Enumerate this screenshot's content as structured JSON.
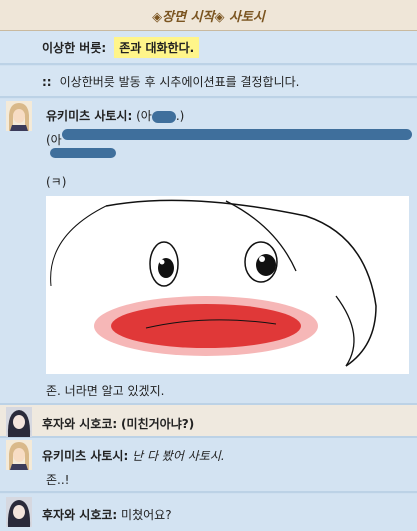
{
  "header": {
    "title": "◈장면 시작◈ 사토시"
  },
  "system": {
    "choice_label": "이상한 버릇:",
    "choice_value": "존과 대화한다.",
    "notice_prefix": "::",
    "notice_text": "이상한버릇 발동 후 시추에이션표를 결정합니다."
  },
  "messages": [
    {
      "speaker": "유키미츠 사토시:",
      "text": "(아",
      "text_tail": ".)",
      "line2": "(아",
      "line4": "(ㅋ)",
      "caption": "존. 너라면 알고 있겠지."
    },
    {
      "speaker": "후자와 시호코:",
      "text": "(미친거아냐?)"
    },
    {
      "speaker": "유키미츠 사토시:",
      "text": "난 다 봤어 사토시.",
      "line2": "존..!"
    },
    {
      "speaker": "후자와 시호코:",
      "text": "미쳤어요?"
    }
  ],
  "colors": {
    "hair": "#d9b98a",
    "dark_hair": "#2a2a3a",
    "accent": "#fff58a"
  }
}
